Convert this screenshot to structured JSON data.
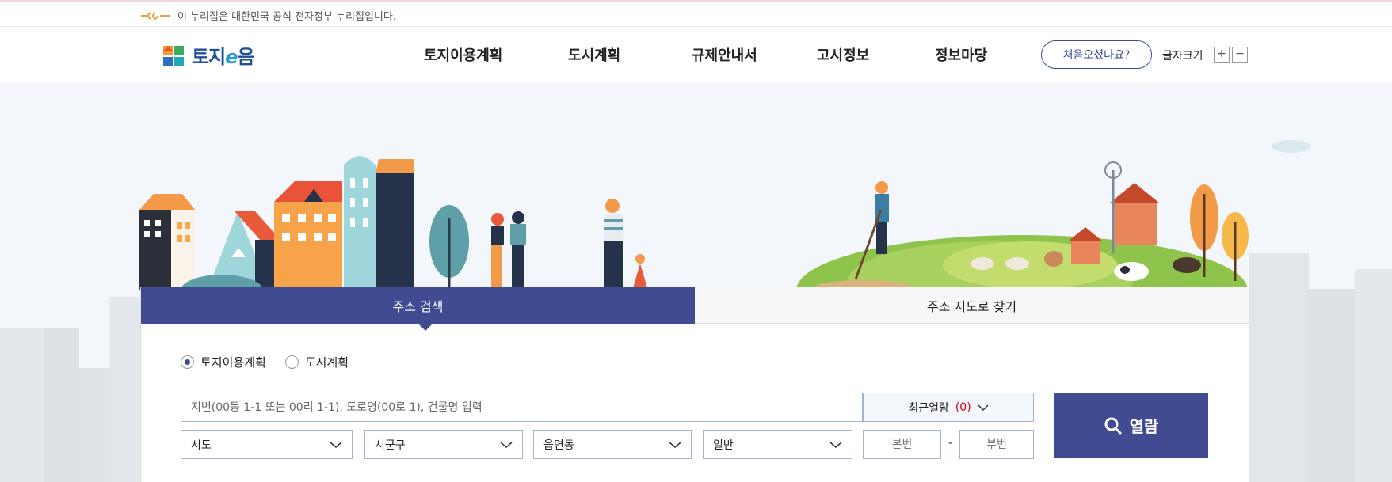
{
  "gov_banner": {
    "text": "이 누리집은 대한민국 공식 전자정부 누리집입니다."
  },
  "logo": {
    "text_main": "토지",
    "text_e": "e",
    "text_end": "음"
  },
  "nav": {
    "items": [
      {
        "label": "토지이용계획"
      },
      {
        "label": "도시계획"
      },
      {
        "label": "규제안내서"
      },
      {
        "label": "고시정보"
      },
      {
        "label": "정보마당"
      }
    ],
    "first_visit": "처음오셨나요?",
    "font_size_label": "글자크기",
    "plus": "+",
    "minus": "−"
  },
  "search": {
    "tabs": [
      {
        "label": "주소 검색",
        "active": true
      },
      {
        "label": "주소 지도로 찾기",
        "active": false
      }
    ],
    "radios": [
      {
        "label": "토지이용계획",
        "checked": true
      },
      {
        "label": "도시계획",
        "checked": false
      }
    ],
    "placeholder": "지번(00동 1-1 또는 00리 1-1), 도로명(00로 1), 건물명 입력",
    "recent_label": "최근열람",
    "recent_count": "(0)",
    "selects": {
      "sido": "시도",
      "sigungu": "시군구",
      "eupmyeondong": "읍면동",
      "type": "일반"
    },
    "main_no_placeholder": "본번",
    "sub_no_placeholder": "부번",
    "dash": "-",
    "view_button": "열람"
  },
  "colors": {
    "primary": "#404b91",
    "accent_red": "#d0021b",
    "border": "#a3b4d3"
  }
}
